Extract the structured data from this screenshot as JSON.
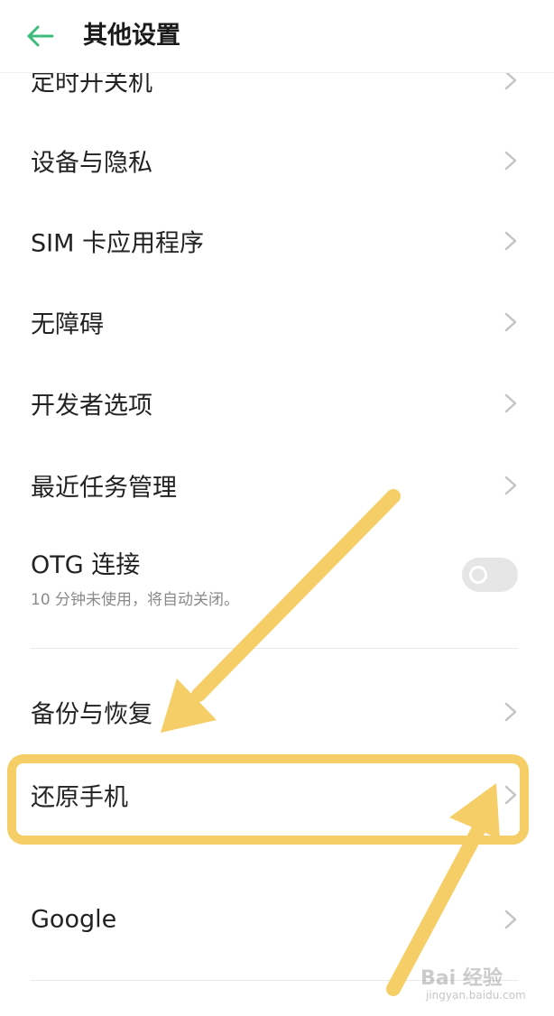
{
  "header": {
    "title": "其他设置",
    "back_icon": "arrow-left-icon",
    "accent_color": "#3dbb7a"
  },
  "rows": {
    "timer_power": "定时开关机",
    "device_privacy": "设备与隐私",
    "sim_apps": "SIM 卡应用程序",
    "accessibility": "无障碍",
    "developer": "开发者选项",
    "recent_tasks": "最近任务管理",
    "backup_restore": "备份与恢复",
    "reset_phone": "还原手机",
    "google": "Google"
  },
  "otg": {
    "title": "OTG 连接",
    "subtitle": "10 分钟未使用，将自动关闭。",
    "enabled": false
  },
  "annotation": {
    "highlight_color": "#f6ce68",
    "arrow_color": "#f6ce68"
  },
  "watermark": {
    "logo": "Bai 经验",
    "url": "jingyan.baidu.com"
  }
}
